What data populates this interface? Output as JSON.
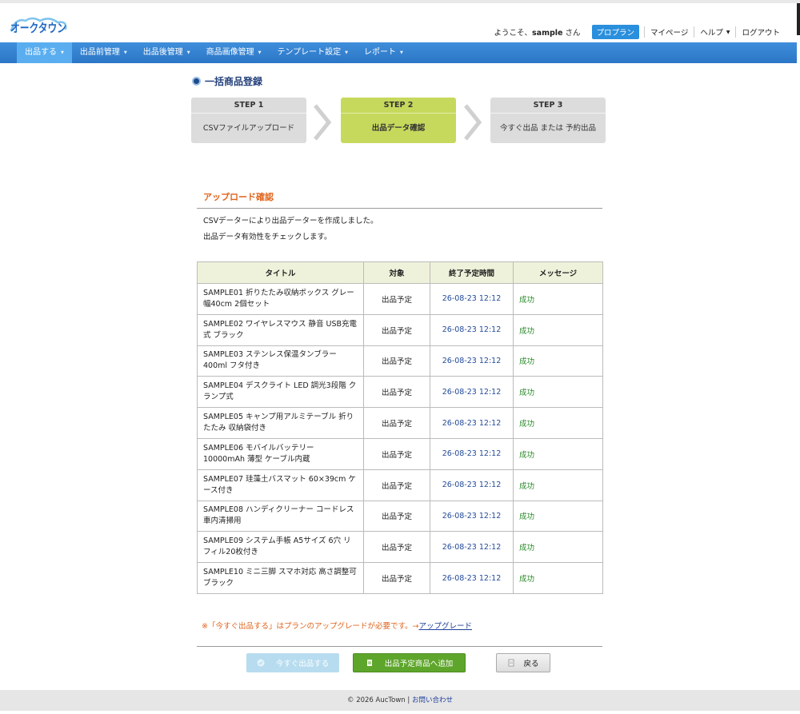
{
  "header": {
    "logo_text": "オークタウン",
    "welcome_prefix": "ようこそ、",
    "username": "sample",
    "welcome_suffix": " さん",
    "plan": "プロプラン",
    "links": [
      "マイページ",
      "ヘルプ",
      "ログアウト"
    ]
  },
  "nav": {
    "items": [
      "出品する",
      "出品前管理",
      "出品後管理",
      "商品画像管理",
      "テンプレート設定",
      "レポート"
    ]
  },
  "page": {
    "title": "一括商品登録"
  },
  "steps": [
    {
      "head": "STEP 1",
      "body": "CSVファイルアップロード"
    },
    {
      "head": "STEP 2",
      "body": "出品データ確認"
    },
    {
      "head": "STEP 3",
      "body": "今すぐ出品 または 予約出品"
    }
  ],
  "section": {
    "title": "アップロード確認",
    "line1": "CSVデーターにより出品データーを作成しました。",
    "line2": "出品データ有効性をチェックします。"
  },
  "table": {
    "headers": [
      "タイトル",
      "対象",
      "終了予定時間",
      "メッセージ"
    ],
    "rows": [
      {
        "title": "SAMPLE01 折りたたみ収納ボックス グレー 幅40cm 2個セット",
        "target": "出品予定",
        "end": "26-08-23 12:12",
        "message": "成功"
      },
      {
        "title": "SAMPLE02 ワイヤレスマウス 静音 USB充電式 ブラック",
        "target": "出品予定",
        "end": "26-08-23 12:12",
        "message": "成功"
      },
      {
        "title": "SAMPLE03 ステンレス保温タンブラー 400ml フタ付き",
        "target": "出品予定",
        "end": "26-08-23 12:12",
        "message": "成功"
      },
      {
        "title": "SAMPLE04 デスクライト LED 調光3段階 クランプ式",
        "target": "出品予定",
        "end": "26-08-23 12:12",
        "message": "成功"
      },
      {
        "title": "SAMPLE05 キャンプ用アルミテーブル 折りたたみ 収納袋付き",
        "target": "出品予定",
        "end": "26-08-23 12:12",
        "message": "成功"
      },
      {
        "title": "SAMPLE06 モバイルバッテリー 10000mAh 薄型 ケーブル内蔵",
        "target": "出品予定",
        "end": "26-08-23 12:12",
        "message": "成功"
      },
      {
        "title": "SAMPLE07 珪藻土バスマット 60×39cm ケース付き",
        "target": "出品予定",
        "end": "26-08-23 12:12",
        "message": "成功"
      },
      {
        "title": "SAMPLE08 ハンディクリーナー コードレス 車内清掃用",
        "target": "出品予定",
        "end": "26-08-23 12:12",
        "message": "成功"
      },
      {
        "title": "SAMPLE09 システム手帳 A5サイズ 6穴 リフィル20枚付き",
        "target": "出品予定",
        "end": "26-08-23 12:12",
        "message": "成功"
      },
      {
        "title": "SAMPLE10 ミニ三脚 スマホ対応 高さ調整可 ブラック",
        "target": "出品予定",
        "end": "26-08-23 12:12",
        "message": "成功"
      }
    ]
  },
  "note": {
    "mark": "※",
    "text": "「今すぐ出品する」はプランのアップグレードが必要です。→",
    "link": "アップグレード"
  },
  "buttons": {
    "now": "今すぐ出品する",
    "add": "出品予定商品へ追加",
    "back": "戻る"
  },
  "footer": {
    "copyright": "© 2026 AucTown | ",
    "contact": "お問い合わせ"
  },
  "colors": {
    "nav": "#2b76c6",
    "nav_active": "#5aaef0",
    "step_active": "#c7d95d",
    "accent_orange": "#e0641c",
    "success": "#2a8a2a",
    "date": "#234a99",
    "add_button": "#5ea62b"
  }
}
